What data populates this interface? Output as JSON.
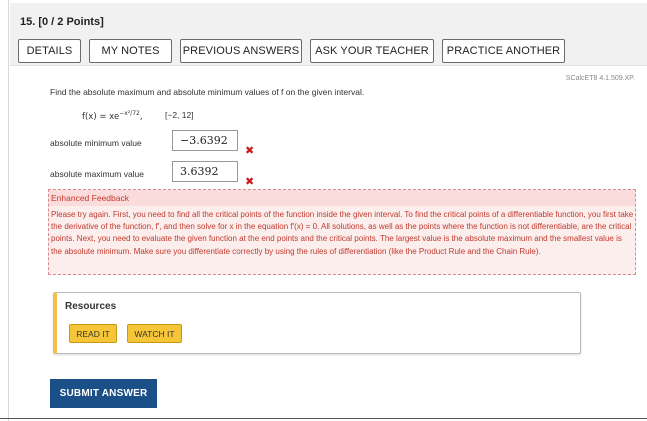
{
  "question": {
    "title": "15.  [0 / 2 Points]",
    "buttons": {
      "details": "DETAILS",
      "my_notes": "MY NOTES",
      "previous_answers": "PREVIOUS ANSWERS",
      "ask_teacher": "ASK YOUR TEACHER",
      "practice_another": "PRACTICE ANOTHER"
    },
    "source": "SCalcET8 4.1.509.XP.",
    "prompt": "Find the absolute maximum and absolute minimum values of f on the given interval.",
    "formula": {
      "lhs": "f(x) = xe",
      "exponent": "−x²/72",
      "comma": ",",
      "interval": "[−2, 12]"
    }
  },
  "answers": {
    "min_label": "absolute minimum value",
    "min_value": "−3.6392",
    "max_label": "absolute maximum value",
    "max_value": "3.6392",
    "incorrect_mark": "✖"
  },
  "feedback": {
    "title": "Enhanced Feedback",
    "text": "Please try again. First, you need to find all the critical points of the function inside the given interval. To find the critical points of a differentiable function, you first take the derivative of the function, f′, and then solve for x in the equation f′(x) = 0. All solutions, as well as the points where the function is not differentiable, are the critical points. Next, you need to evaluate the given function at the end points and the critical points. The largest value is the absolute maximum and the smallest value is the absolute minimum. Make sure you differentiate correctly by using the rules of differentiation (like the Product Rule and the Chain Rule)."
  },
  "resources": {
    "title": "Resources",
    "read_it": "READ IT",
    "watch_it": "WATCH IT"
  },
  "submit_label": "SUBMIT ANSWER",
  "colors": {
    "submit_bg": "#1b4f87",
    "resource_btn": "#f7c638",
    "error_red": "#c81e1e",
    "feedback_bg": "#fdeeee"
  }
}
